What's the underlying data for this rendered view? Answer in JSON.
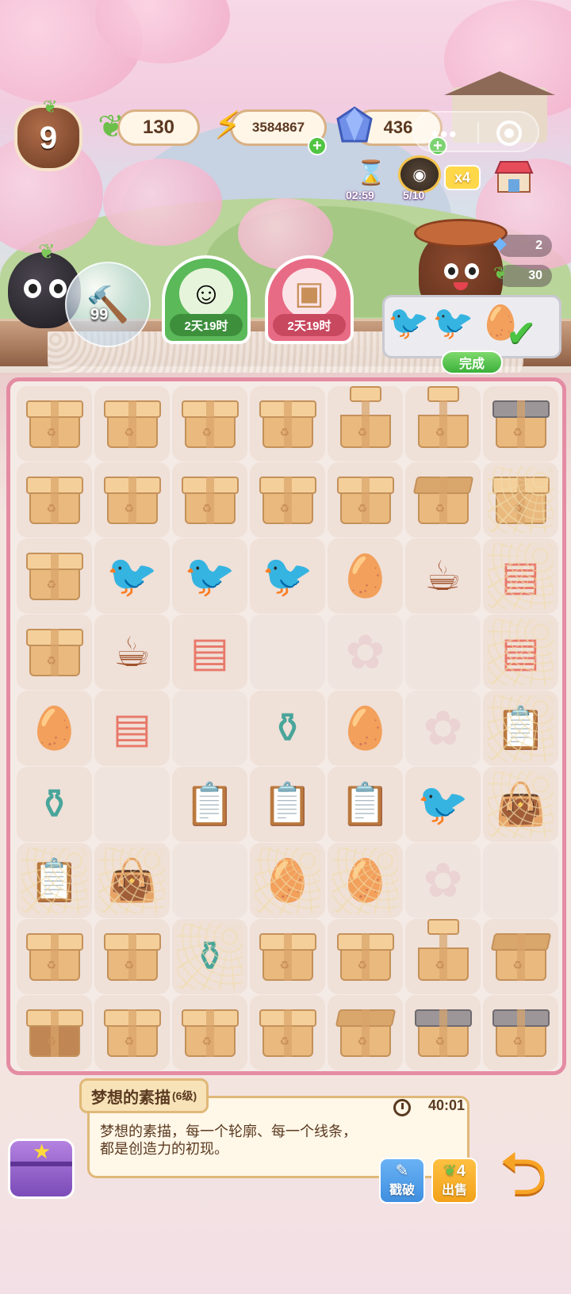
{
  "hud": {
    "player_level": "9",
    "sprouts": "130",
    "energy": "3584867",
    "gems": "436",
    "menu_dots": "•••",
    "event_timer": "02:59",
    "collect_progress": "5/10",
    "multiplier": "x4"
  },
  "tool_bubble": {
    "count": "99"
  },
  "quests": [
    {
      "timer": "2天19时",
      "color": "#4caf50"
    },
    {
      "timer": "2天19时",
      "color": "#e0607a"
    }
  ],
  "order": {
    "reward_cubes": "2",
    "reward_sprouts": "30",
    "done_label": "完成"
  },
  "board": {
    "rows": [
      [
        "box",
        "box",
        "box",
        "box",
        "box-stack",
        "box-stack",
        "box-covered"
      ],
      [
        "box",
        "box",
        "box",
        "box",
        "box",
        "box-open",
        "box-web"
      ],
      [
        "box",
        "bird",
        "bird",
        "bird",
        "egg",
        "coffee",
        "cats-web"
      ],
      [
        "box",
        "coffee",
        "cats",
        "empty",
        "ghost",
        "empty",
        "cats-web"
      ],
      [
        "egg",
        "cats",
        "empty",
        "vase",
        "egg",
        "ghost",
        "clip-web"
      ],
      [
        "vase",
        "empty",
        "clip",
        "clip",
        "clip",
        "bird",
        "bag-web"
      ],
      [
        "clip-web",
        "bag-web",
        "empty",
        "egg-web",
        "egg-web",
        "ghost",
        "empty"
      ],
      [
        "box",
        "box",
        "vase-web",
        "box-flat",
        "box",
        "box-stack",
        "box-open"
      ],
      [
        "box-dark",
        "box",
        "box",
        "box",
        "box-open",
        "box-covered",
        "box-covered"
      ]
    ]
  },
  "info": {
    "title": "梦想的素描",
    "level": "(6级)",
    "time": "40:01",
    "desc": "梦想的素描，每一个轮廓、每一个线条，都是创造力的初现。",
    "break_label": "戳破",
    "sell_price": "4",
    "sell_label": "出售"
  },
  "colors": {
    "board_border": "#e48ca3",
    "panel_border": "#e0b878",
    "break_btn": "#3f8fe0",
    "sell_btn": "#f2a21a"
  },
  "icons": {
    "energy": "lightning-icon",
    "gem": "gem-icon",
    "sprout": "sprout-icon",
    "shop": "shop-icon",
    "check": "check-icon",
    "back": "back-arrow-icon"
  }
}
